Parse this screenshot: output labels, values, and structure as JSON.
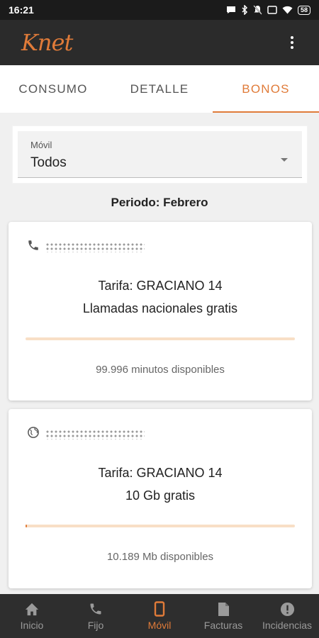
{
  "status_bar": {
    "time": "16:21",
    "battery": "58"
  },
  "app": {
    "logo": "Knet"
  },
  "tabs": [
    {
      "label": "CONSUMO",
      "active": false
    },
    {
      "label": "DETALLE",
      "active": false
    },
    {
      "label": "BONOS",
      "active": true
    }
  ],
  "movil_select": {
    "label": "Móvil",
    "value": "Todos"
  },
  "period": "Periodo: Febrero",
  "bonos": [
    {
      "line_icon": "phone-icon",
      "tariff": "Tarifa: GRACIANO 14",
      "description": "Llamadas nacionales gratis",
      "progress_fraction": 0.0,
      "available": "99.996 minutos disponibles"
    },
    {
      "line_icon": "globe-icon",
      "tariff": "Tarifa: GRACIANO 14",
      "description": "10 Gb gratis",
      "progress_fraction": 0.005,
      "available": "10.189 Mb disponibles"
    }
  ],
  "bottom_nav": [
    {
      "label": "Inicio",
      "icon": "home-icon",
      "active": false
    },
    {
      "label": "Fijo",
      "icon": "phone-icon",
      "active": false
    },
    {
      "label": "Móvil",
      "icon": "mobile-icon",
      "active": true
    },
    {
      "label": "Facturas",
      "icon": "document-icon",
      "active": false
    },
    {
      "label": "Incidencias",
      "icon": "alert-icon",
      "active": false
    }
  ],
  "colors": {
    "accent": "#e07b39",
    "app_bar": "#2b2b2b",
    "nav_bar": "#2e2e2e",
    "progress_track": "#f8dfc6"
  }
}
